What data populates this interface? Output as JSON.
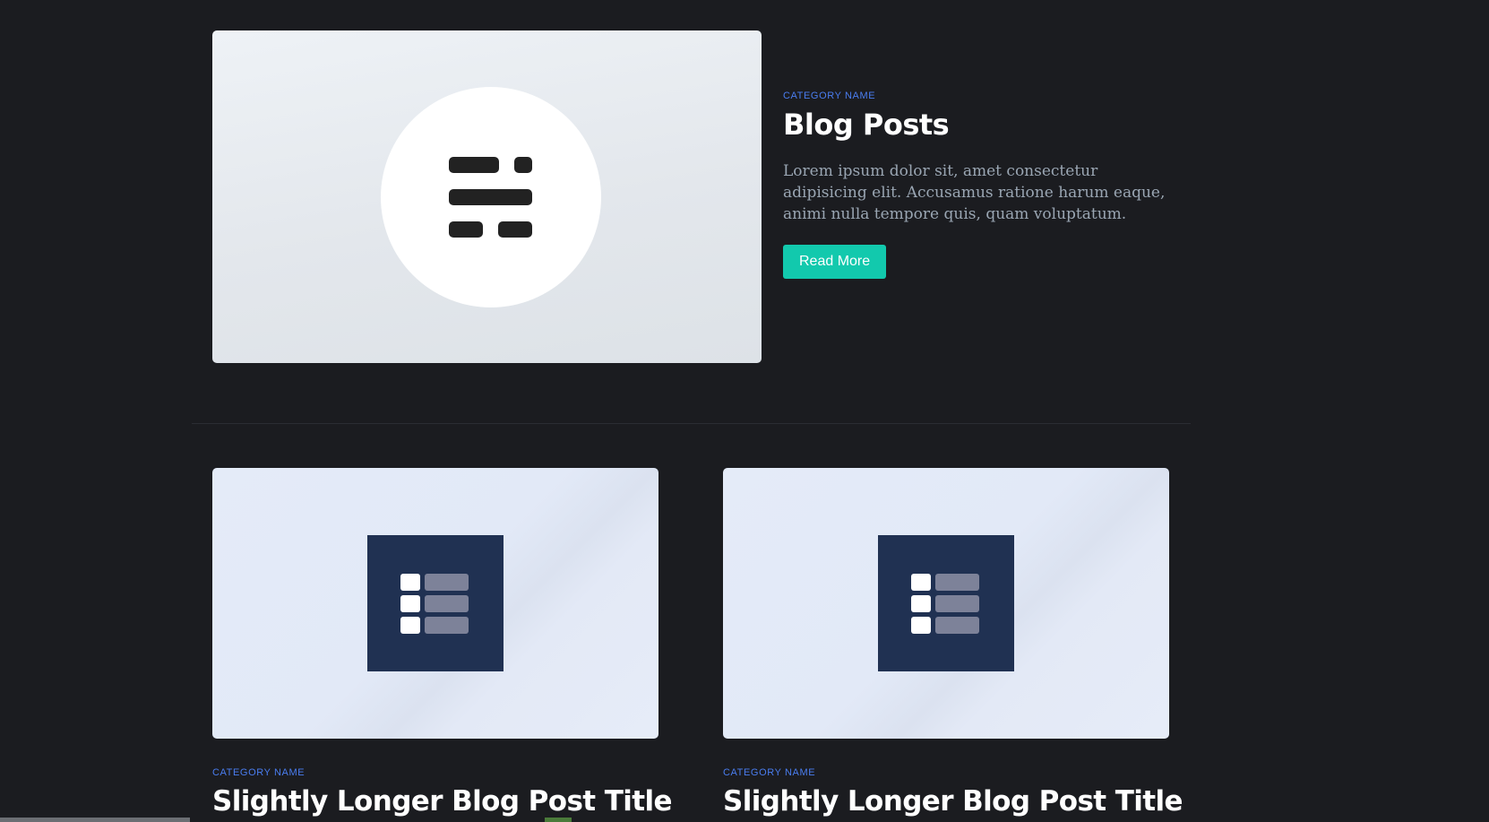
{
  "featured": {
    "category": "CATEGORY NAME",
    "title": "Blog Posts",
    "excerpt": "Lorem ipsum dolor sit, amet consectetur adipisicing elit. Accusamus ratione harum eaque, animi nulla tempore quis, quam voluptatum.",
    "button_label": "Read More",
    "image_icon": "blog-posts-icon"
  },
  "posts": [
    {
      "category": "CATEGORY NAME",
      "title": "Slightly Longer Blog Post Title",
      "image_icon": "list-layout-icon"
    },
    {
      "category": "CATEGORY NAME",
      "title": "Slightly Longer Blog Post Title",
      "image_icon": "list-layout-icon"
    }
  ],
  "colors": {
    "background": "#1b1c20",
    "accent_category": "#4a7df0",
    "button": "#12c9ad",
    "card_icon_bg": "#203152"
  }
}
